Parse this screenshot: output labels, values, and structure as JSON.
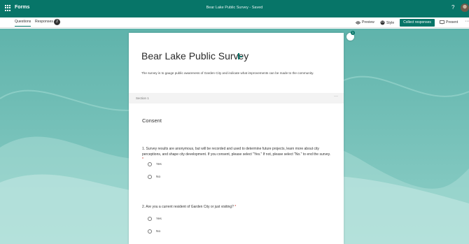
{
  "topbar": {
    "app_name": "Forms",
    "doc_title": "Bear Lake Public Survey - Saved",
    "help_icon": "question-mark-icon",
    "avatar": "user-avatar"
  },
  "toolbar": {
    "tabs": [
      {
        "label": "Questions"
      },
      {
        "label": "Responses"
      }
    ],
    "responses_count": "2",
    "preview_label": "Preview",
    "style_label": "Style",
    "collect_label": "Collect responses",
    "present_label": "Present",
    "more_label": "···"
  },
  "form": {
    "title": "Bear Lake Public Survey",
    "description": "The survey is to gauge public awareness of Garden City and indicate what improvements can be made to the community.",
    "section_label": "Section 1",
    "section_more": "···",
    "section_heading": "Consent",
    "questions": [
      {
        "text": "1. Survey results are anonymous, but will be recorded and used to determine future projects, learn more about city perceptions, and shape city development. If you consent, please select \"Yes.\" If not, please select \"No.\" to end the survey.",
        "required_mark": "*",
        "options": [
          "Yes",
          "No"
        ]
      },
      {
        "text": "2. Are you a current resident of Garden City or just visiting?",
        "required_mark": "*",
        "options": [
          "Yes",
          "No"
        ]
      }
    ]
  },
  "theme_badge": "1",
  "colors": {
    "brand": "#077568",
    "background": "#6fbfb7"
  }
}
